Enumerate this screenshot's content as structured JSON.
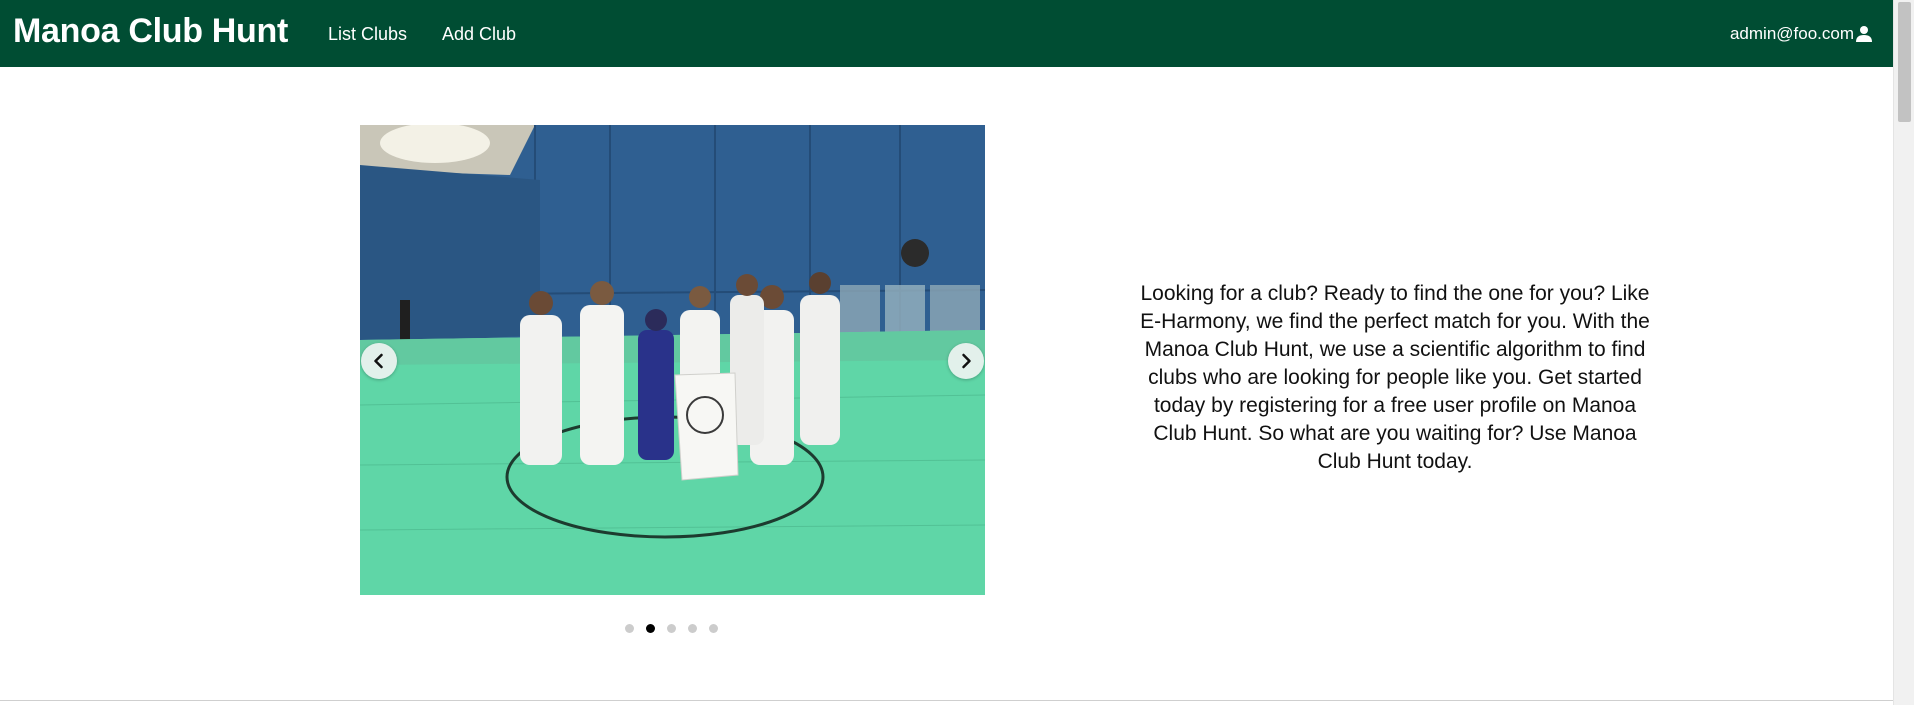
{
  "colors": {
    "navbar_bg": "#004d33",
    "navbar_text": "#ffffff",
    "page_bg": "#ffffff",
    "dot_active": "#000000",
    "dot_inactive": "#cccccc"
  },
  "navbar": {
    "brand": "Manoa Club Hunt",
    "links": [
      {
        "label": "List Clubs"
      },
      {
        "label": "Add Club"
      }
    ],
    "user": {
      "email": "admin@foo.com",
      "icon": "user-icon"
    }
  },
  "carousel": {
    "image_description_icon": "judo-team-photo",
    "prev_icon": "chevron-left-icon",
    "next_icon": "chevron-right-icon",
    "slide_count": 5,
    "active_index": 1
  },
  "main": {
    "tagline": "Looking for a club? Ready to find the one for you? Like E-Harmony, we find the perfect match for you. With the Manoa Club Hunt, we use a scientific algorithm to find clubs who are looking for people like you. Get started today by registering for a free user profile on Manoa Club Hunt. So what are you waiting for? Use Manoa Club Hunt today."
  }
}
